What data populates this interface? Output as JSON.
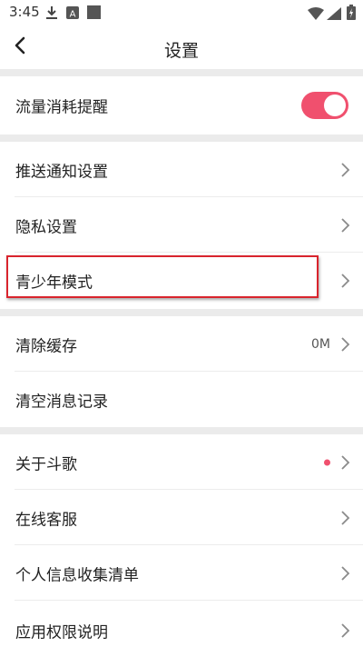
{
  "status_bar": {
    "time": "3:45",
    "left_icons": [
      "download-icon",
      "a-box-icon",
      "square-notification-icon"
    ],
    "right_icons": [
      "wifi-icon",
      "signal-icon",
      "battery-charging-icon"
    ]
  },
  "header": {
    "back_icon": "chevron-left-icon",
    "title": "设置"
  },
  "sections": [
    {
      "items": [
        {
          "label": "流量消耗提醒",
          "control": "toggle",
          "toggle_on": true
        }
      ]
    },
    {
      "items": [
        {
          "label": "推送通知设置",
          "control": "chevron"
        },
        {
          "label": "隐私设置",
          "control": "chevron"
        },
        {
          "label": "青少年模式",
          "control": "chevron",
          "highlighted": true
        }
      ]
    },
    {
      "items": [
        {
          "label": "清除缓存",
          "value": "0M",
          "control": "chevron"
        },
        {
          "label": "清空消息记录",
          "control": "none"
        }
      ]
    },
    {
      "items": [
        {
          "label": "关于斗歌",
          "control": "chevron",
          "badge": "red-dot"
        },
        {
          "label": "在线客服",
          "control": "chevron"
        },
        {
          "label": "个人信息收集清单",
          "control": "chevron"
        },
        {
          "label": "应用权限说明",
          "control": "chevron"
        }
      ]
    }
  ],
  "colors": {
    "toggle_on": "#f0506e",
    "badge_dot": "#f0506e",
    "highlight_border": "#d9242d",
    "section_gap": "#ebebeb",
    "chevron": "#8a8a8a"
  }
}
